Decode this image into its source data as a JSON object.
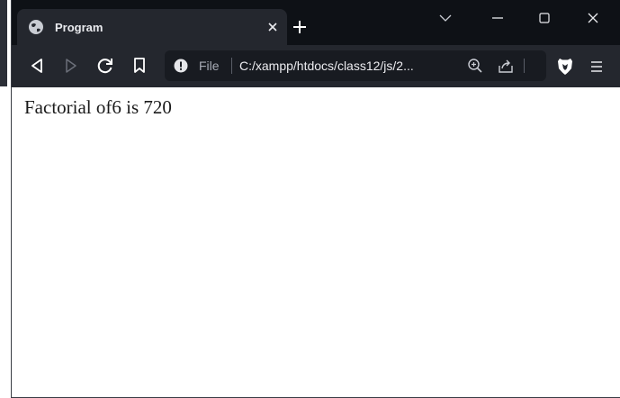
{
  "tab": {
    "title": "Program"
  },
  "address_bar": {
    "scheme_label": "File",
    "url": "C:/xampp/htdocs/class12/js/2..."
  },
  "page": {
    "output_text": "Factorial of6 is 720"
  },
  "icons": {
    "favicon": "globe-icon",
    "tab_close": "close-icon",
    "new_tab": "plus-icon",
    "tab_search": "chevron-down-icon",
    "minimize": "minimize-icon",
    "maximize": "maximize-icon",
    "close_window": "close-icon",
    "back": "back-triangle-icon",
    "forward": "forward-triangle-icon",
    "reload": "reload-icon",
    "bookmark": "bookmark-icon",
    "site_info": "info-icon",
    "zoom": "zoom-icon",
    "share": "share-icon",
    "shields": "brave-shield-icon",
    "menu": "hamburger-menu-icon"
  },
  "colors": {
    "titlebar": "#0e1116",
    "toolbar": "#24272e",
    "urlbar": "#181b21",
    "page_background": "#ffffff"
  }
}
